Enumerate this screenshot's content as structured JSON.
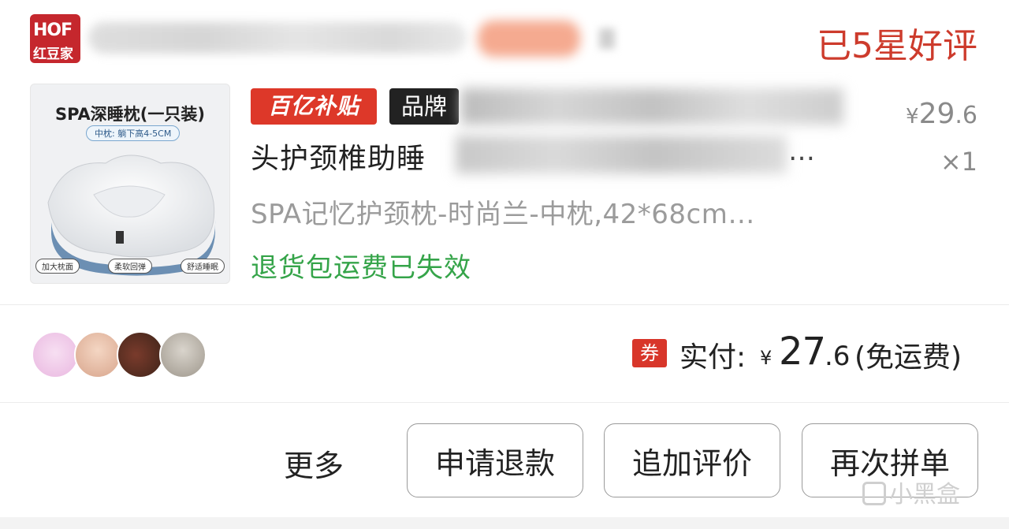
{
  "shop": {
    "logo_top": "HOF",
    "logo_bottom": "红豆家",
    "status": "已5星好评"
  },
  "product": {
    "thumb_title": "SPA深睡枕(一只装)",
    "thumb_subtitle": "中枕: 躺下高4-5CM",
    "thumb_tags": [
      "加大枕面",
      "柔软回弹",
      "舒适睡眠"
    ],
    "badge_subsidy": "百亿补贴",
    "badge_brand": "品牌",
    "title_line2": "头护颈椎助睡",
    "title_ellipsis": "…",
    "spec": "SPA记忆护颈枕-时尚兰-中枕,42*68cm…",
    "return_note": "退货包运费已失效",
    "price_yen": "¥",
    "price_int": "29",
    "price_dec": ".6",
    "quantity": "×1"
  },
  "payment": {
    "coupon": "券",
    "label": "实付:",
    "yen": "¥",
    "amount_int": "27",
    "amount_dec": ".6",
    "note": "(免运费)"
  },
  "actions": {
    "more": "更多",
    "refund": "申请退款",
    "review": "追加评价",
    "reorder": "再次拼单"
  },
  "watermark": "小黑盒",
  "colors": {
    "status_red": "#cd3b2c",
    "subsidy_red": "#dd3829",
    "return_green": "#35a449",
    "coupon_red": "#d8362a"
  }
}
